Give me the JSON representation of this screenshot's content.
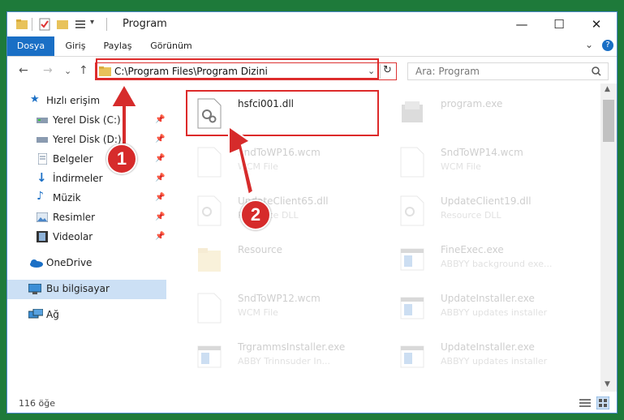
{
  "window": {
    "title": "Program",
    "controls": {
      "minimize": "—",
      "maximize": "☐",
      "close": "✕"
    }
  },
  "ribbon": {
    "tabs": [
      {
        "label": "Dosya",
        "active": true
      },
      {
        "label": "Giriş"
      },
      {
        "label": "Paylaş"
      },
      {
        "label": "Görünüm"
      }
    ],
    "expand": "⌄",
    "help": "?"
  },
  "nav": {
    "back": "←",
    "forward": "→",
    "recent": "⌄",
    "up": "↑",
    "address": "C:\\Program Files\\Program Dizini",
    "search_placeholder": "Ara: Program"
  },
  "sidebar": {
    "items": [
      {
        "label": "Hızlı erişim",
        "icon": "star-icon"
      },
      {
        "label": "Yerel Disk (C:)",
        "icon": "drive-icon",
        "pinned": true
      },
      {
        "label": "Yerel Disk (D:)",
        "icon": "drive-icon",
        "pinned": true
      },
      {
        "label": "Belgeler",
        "icon": "document-icon",
        "pinned": true
      },
      {
        "label": "İndirmeler",
        "icon": "download-icon",
        "pinned": true
      },
      {
        "label": "Müzik",
        "icon": "music-icon",
        "pinned": true
      },
      {
        "label": "Resimler",
        "icon": "pictures-icon",
        "pinned": true
      },
      {
        "label": "Videolar",
        "icon": "video-icon",
        "pinned": true
      },
      {
        "label": "OneDrive",
        "icon": "cloud-icon"
      },
      {
        "label": "Bu bilgisayar",
        "icon": "computer-icon",
        "selected": true
      },
      {
        "label": "Ağ",
        "icon": "network-icon"
      }
    ]
  },
  "files": [
    {
      "name": "hsfci001.dll",
      "sub": "",
      "icon": "dll-icon",
      "faded": false
    },
    {
      "name": "program.exe",
      "sub": "",
      "icon": "exe-icon",
      "faded": true
    },
    {
      "name": "SndToWP16.wcm",
      "sub": "WCM File",
      "icon": "blank-file-icon",
      "faded": true
    },
    {
      "name": "SndToWP14.wcm",
      "sub": "WCM File",
      "icon": "blank-file-icon",
      "faded": true
    },
    {
      "name": "UpdateClient65.dll",
      "sub": "Resource DLL",
      "icon": "dll-icon",
      "faded": true
    },
    {
      "name": "UpdateClient19.dll",
      "sub": "Resource DLL",
      "icon": "dll-icon",
      "faded": true
    },
    {
      "name": "Resource",
      "sub": "",
      "icon": "folder-icon",
      "faded": true
    },
    {
      "name": "FineExec.exe",
      "sub": "ABBYY background exe...",
      "icon": "app-window-icon",
      "faded": true
    },
    {
      "name": "SndToWP12.wcm",
      "sub": "WCM File",
      "icon": "blank-file-icon",
      "faded": true
    },
    {
      "name": "UpdateInstaller.exe",
      "sub": "ABBYY updates installer",
      "icon": "app-window-icon",
      "faded": true
    },
    {
      "name": "TrgrammsInstaller.exe",
      "sub": "ABBY Trinnsuder In...",
      "icon": "app-window-icon",
      "faded": true
    },
    {
      "name": "UpdateInstaller.exe",
      "sub": "ABBYY updates installer",
      "icon": "app-window-icon",
      "faded": true
    }
  ],
  "status": {
    "count": "116 öğe"
  },
  "annotations": {
    "badge1": "1",
    "badge2": "2"
  },
  "colors": {
    "accent": "#1a6fc5",
    "highlight": "#dd2a2a",
    "selected": "#cce0f5"
  }
}
